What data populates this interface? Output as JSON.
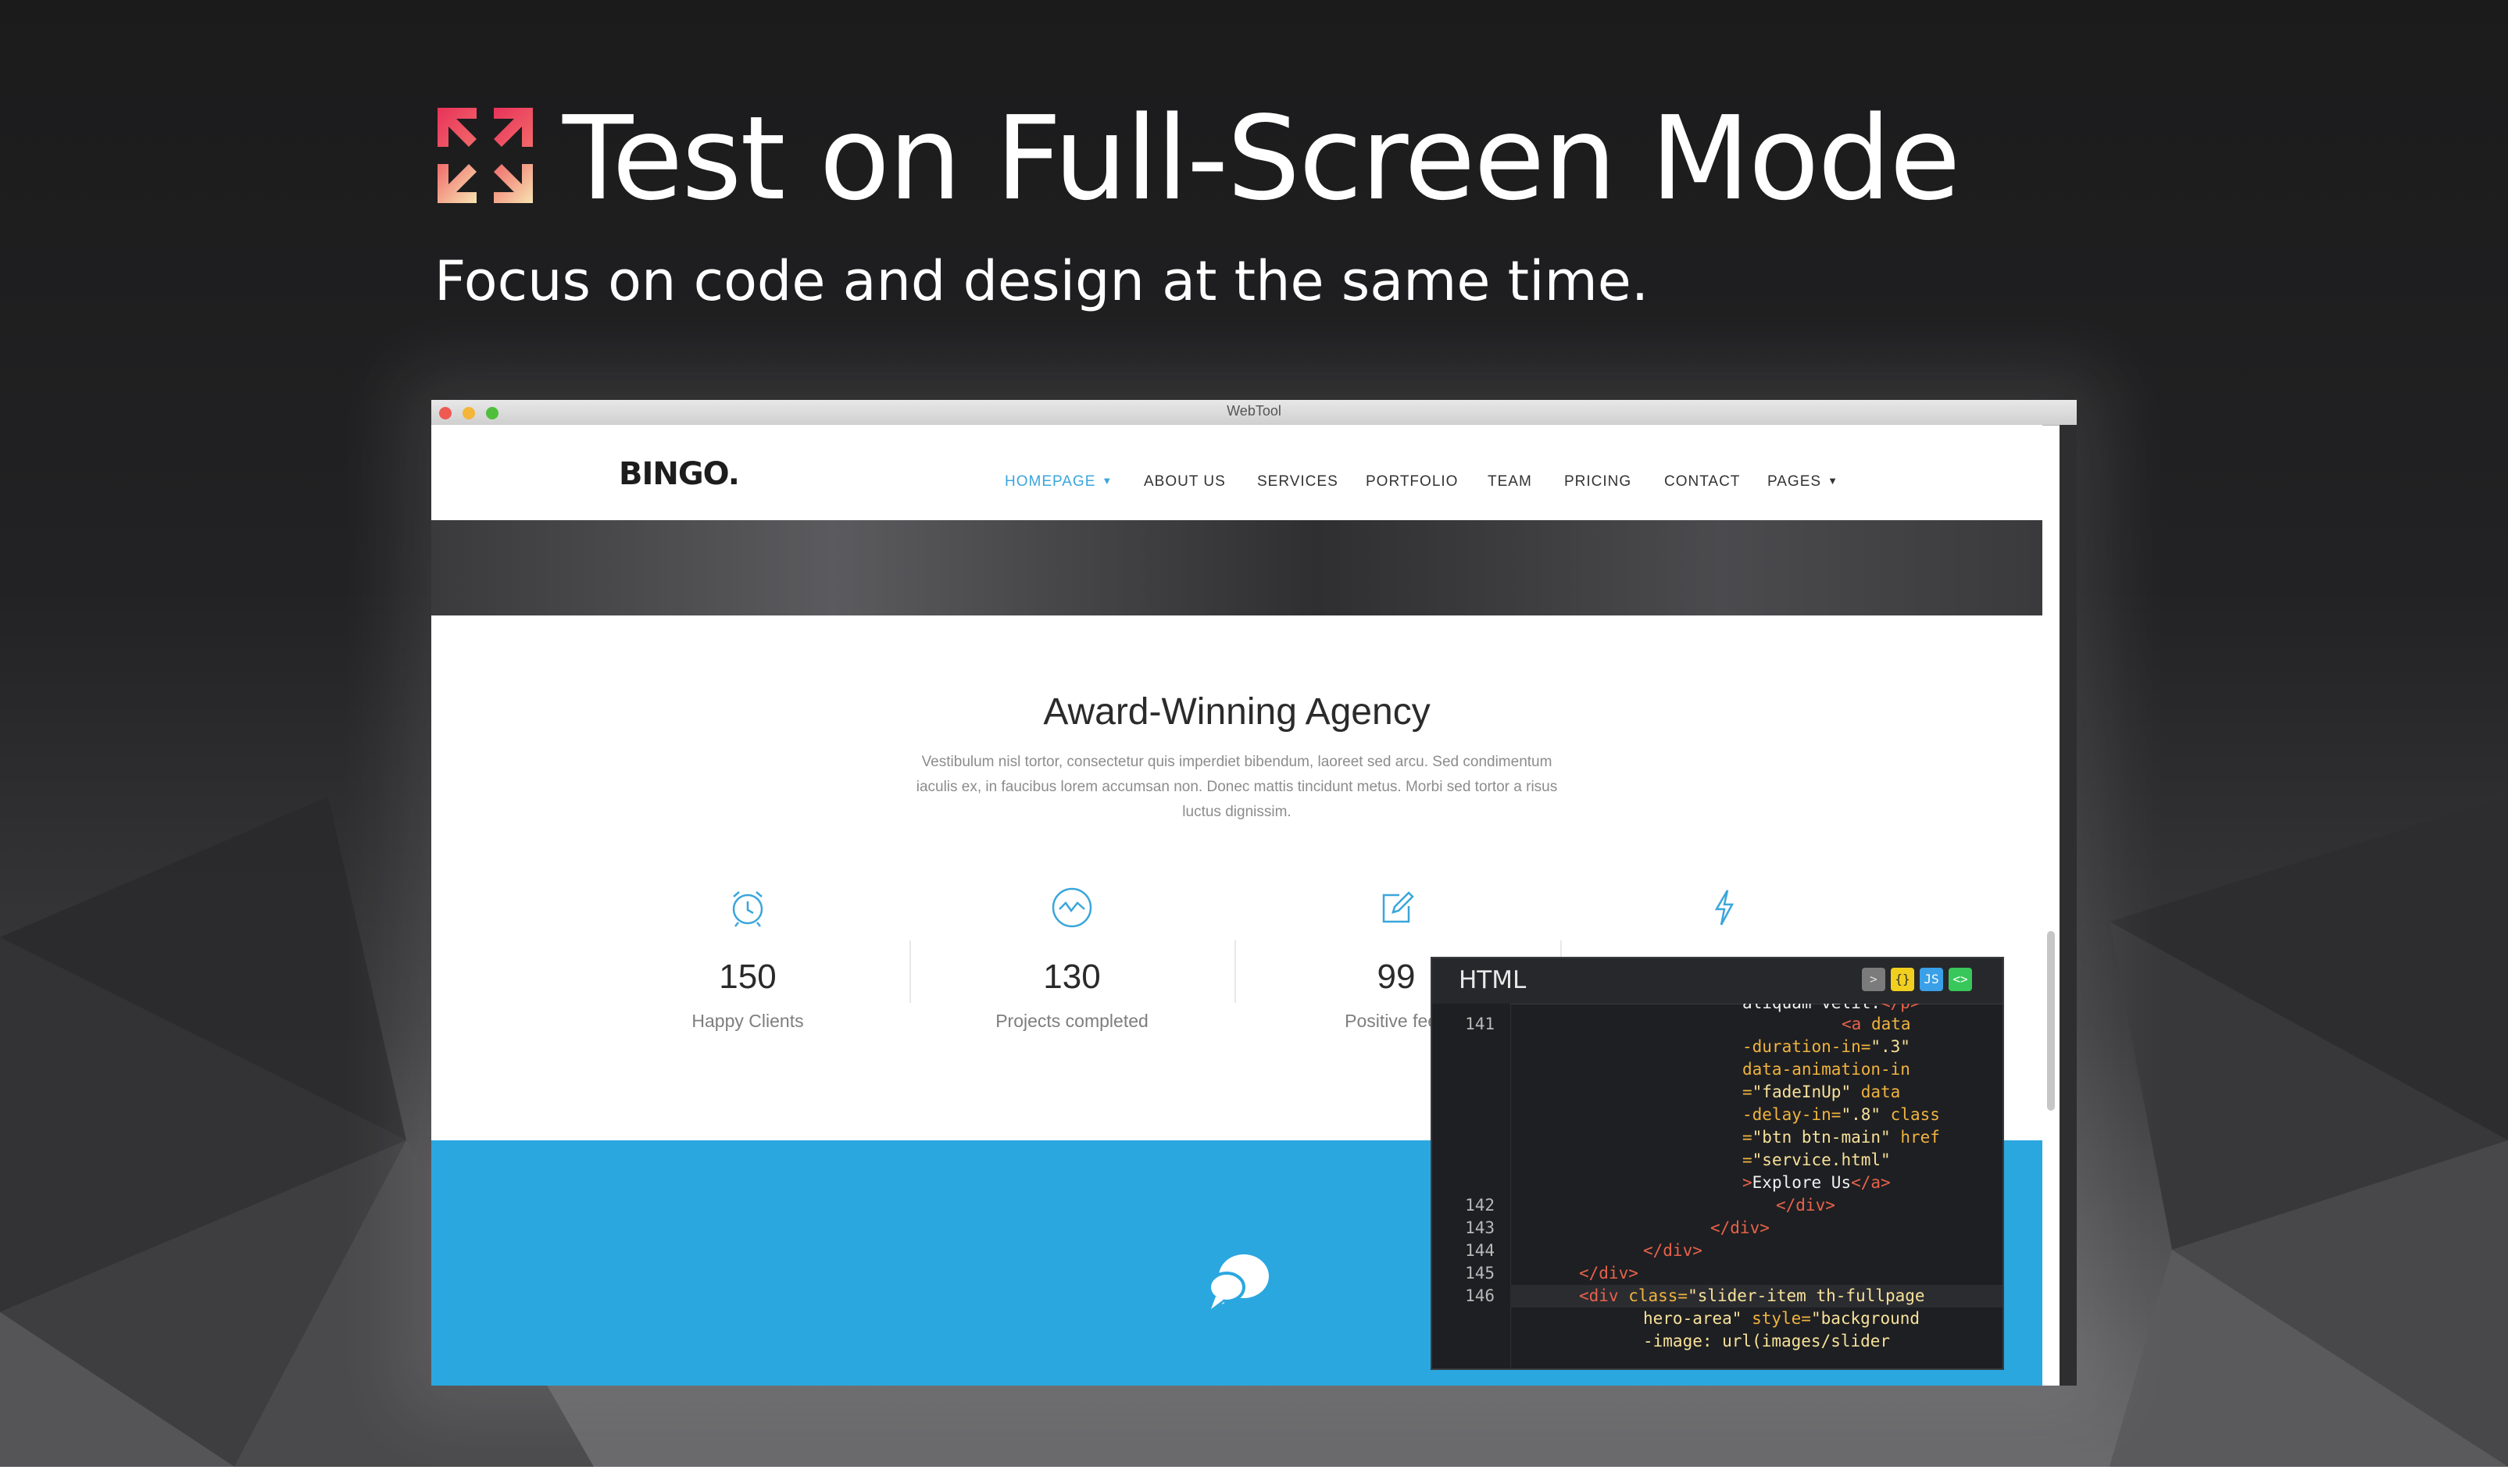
{
  "header": {
    "headline": "Test on Full-Screen Mode",
    "subheadline": "Focus on code and design at the same time."
  },
  "window": {
    "title": "WebTool"
  },
  "site": {
    "brand": "BINGO.",
    "nav": [
      {
        "label": "HOMEPAGE",
        "active": true,
        "dropdown": true
      },
      {
        "label": "ABOUT US"
      },
      {
        "label": "SERVICES"
      },
      {
        "label": "PORTFOLIO"
      },
      {
        "label": "TEAM"
      },
      {
        "label": "PRICING"
      },
      {
        "label": "CONTACT"
      },
      {
        "label": "PAGES",
        "dropdown": true
      }
    ],
    "section_title": "Award-Winning Agency",
    "section_text": "Vestibulum nisl tortor, consectetur quis imperdiet bibendum, laoreet sed arcu. Sed condimentum iaculis ex, in faucibus lorem accumsan non. Donec mattis tincidunt metus. Morbi sed tortor a risus luctus dignissim.",
    "stats": [
      {
        "icon": "alarm-clock-icon",
        "value": "150",
        "label": "Happy Clients"
      },
      {
        "icon": "activity-circle-icon",
        "value": "130",
        "label": "Projects completed"
      },
      {
        "icon": "edit-icon",
        "value": "99",
        "label": "Positive feed"
      },
      {
        "icon": "lightning-icon",
        "value": "",
        "label": ""
      }
    ],
    "accent_color": "#3aa6db",
    "band_color": "#2ba7e0"
  },
  "code_panel": {
    "title": "HTML",
    "controls": [
      {
        "name": "collapse-control-icon",
        "glyph": ">"
      },
      {
        "name": "css-control-icon",
        "glyph": "{}"
      },
      {
        "name": "js-control-icon",
        "glyph": "JS"
      },
      {
        "name": "html-control-icon",
        "glyph": "<>"
      }
    ],
    "line_numbers": [
      "141",
      "142",
      "143",
      "144",
      "145",
      "146"
    ]
  }
}
